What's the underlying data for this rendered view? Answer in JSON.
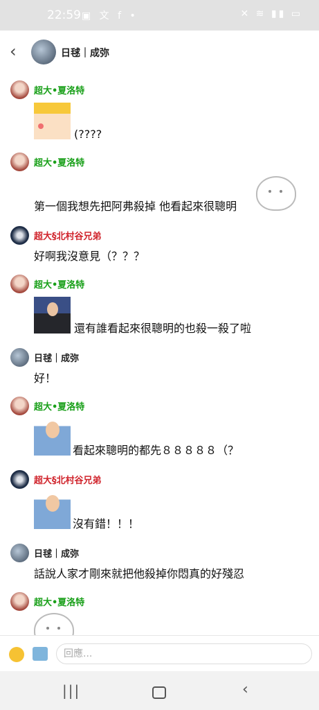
{
  "status_bar": {
    "time": "22:59",
    "left_icons": [
      "gallery-icon",
      "translate-icon",
      "facebook-icon",
      "dot-icon"
    ],
    "left_glyphs": "▣ 文 f •",
    "right_icons": [
      "mute-icon",
      "wifi-icon",
      "signal-icon",
      "battery-icon"
    ],
    "right_glyphs": "✕ ≋ ▮▮ ▭"
  },
  "header": {
    "back_glyph": "‹",
    "title": "日毬｜成弥"
  },
  "messages": [
    {
      "sender": "超大•夏洛特",
      "color": "#1aa01a",
      "text": "(????",
      "sticker": "cartoon-girl"
    },
    {
      "sender": "超大•夏洛特",
      "color": "#1aa01a",
      "text": "第一個我想先把阿弗殺掉 他看起來很聰明",
      "sticker": "white-cat"
    },
    {
      "sender": "超大§北村谷兄弟",
      "color": "#d0242c",
      "text": "好啊我沒意見（？？？"
    },
    {
      "sender": "超大•夏洛特",
      "color": "#1aa01a",
      "text": "還有誰看起來很聰明的也殺一殺了啦",
      "sticker": "news-anchor"
    },
    {
      "sender": "日毬｜成弥",
      "color": "#222222",
      "text": "好！"
    },
    {
      "sender": "超大•夏洛特",
      "color": "#1aa01a",
      "text": "看起來聰明的都先８８８８８（？",
      "sticker": "thumbs-up-man"
    },
    {
      "sender": "超大§北村谷兄弟",
      "color": "#d0242c",
      "text": "沒有錯！！！",
      "sticker": "thumbs-up-man"
    },
    {
      "sender": "日毬｜成弥",
      "color": "#222222",
      "text": "話說人家才剛來就把他殺掉你悶真的好殘忍"
    },
    {
      "sender": "超大•夏洛特",
      "color": "#1aa01a",
      "text": "",
      "sticker": "white-cat"
    }
  ],
  "composer": {
    "placeholder": "回應..."
  },
  "nav_bar": {
    "recents": "|||",
    "back": "‹"
  }
}
